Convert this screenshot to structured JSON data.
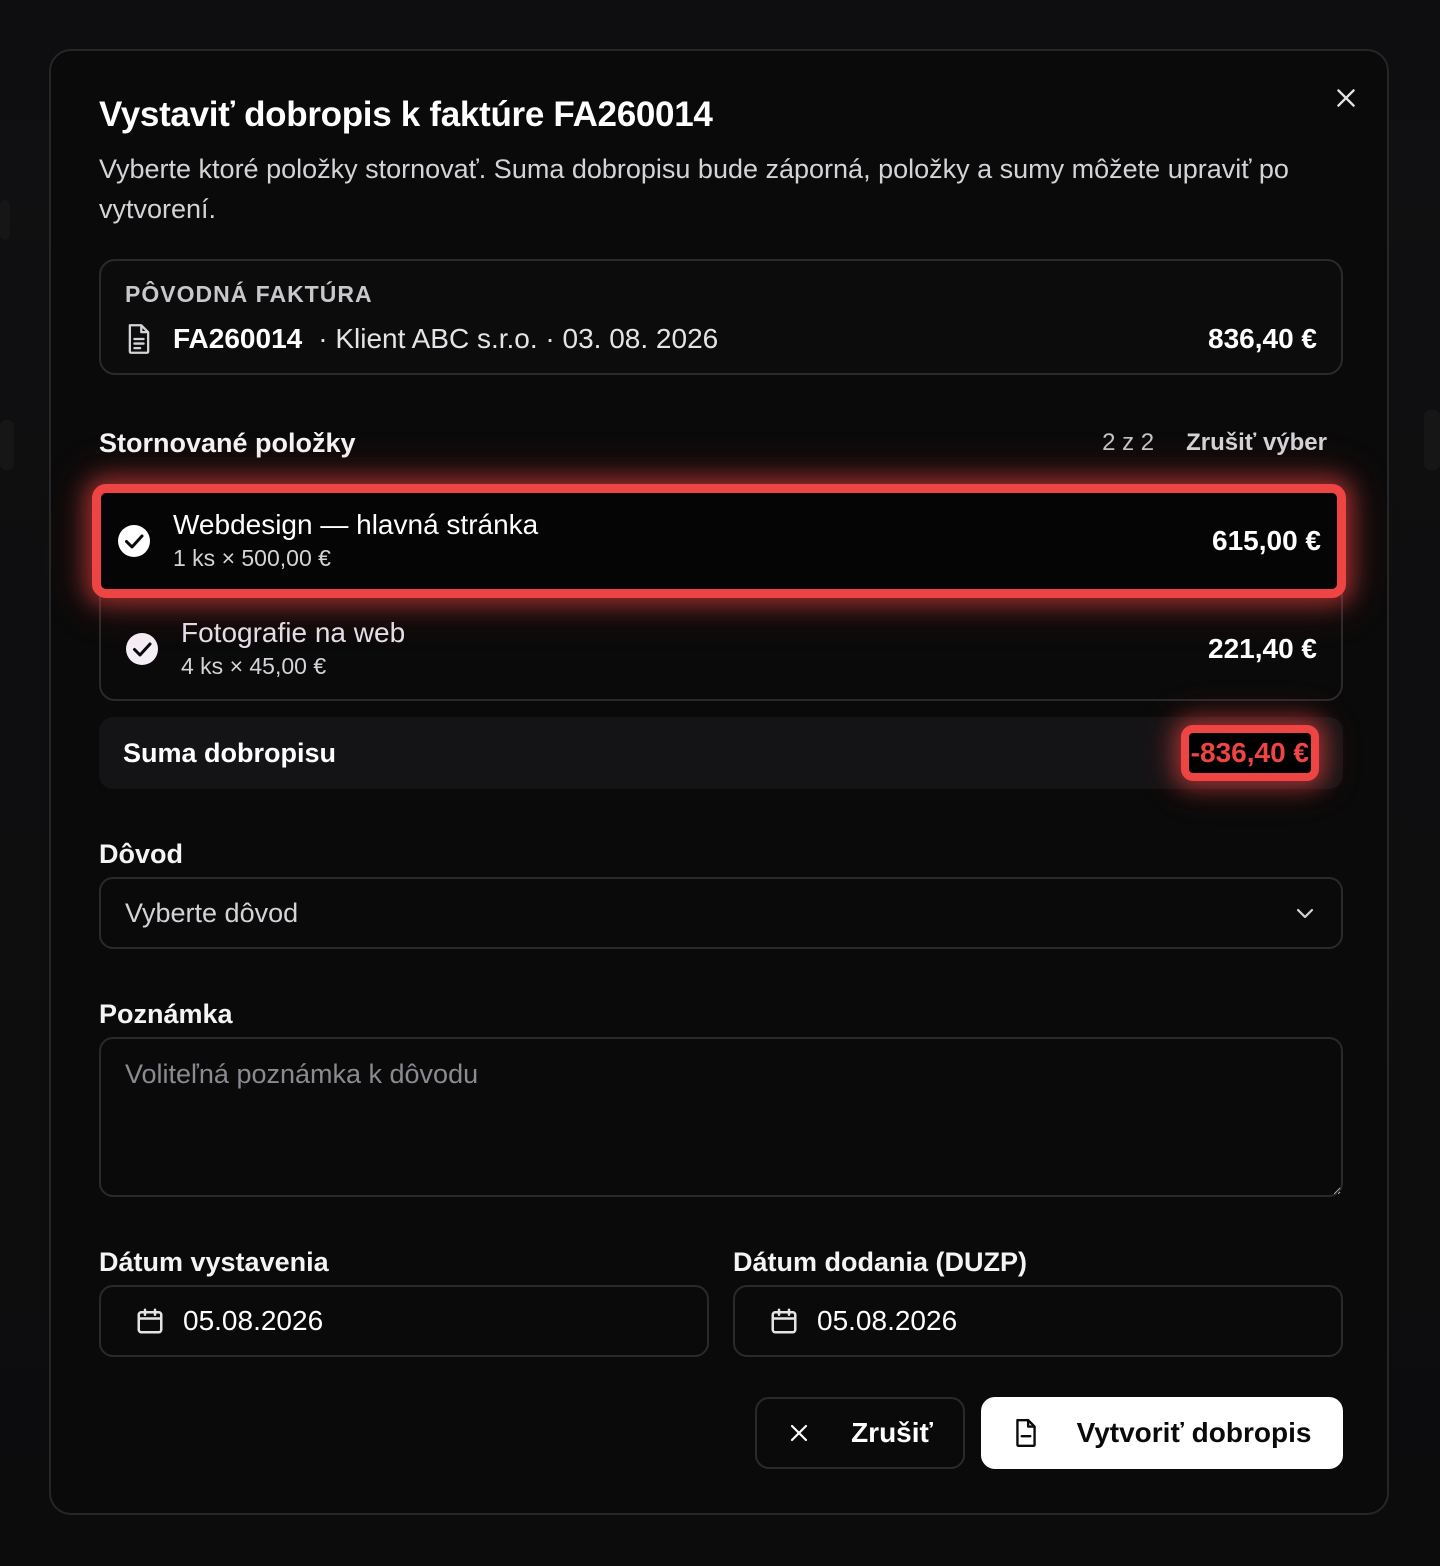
{
  "modal": {
    "title": "Vystaviť dobropis k faktúre FA260014",
    "subtitle": "Vyberte ktoré položky stornovať. Suma dobropisu bude záporná, položky a sumy môžete upraviť po vytvorení.",
    "close_icon": "close-icon"
  },
  "original_invoice": {
    "label": "PÔVODNÁ FAKTÚRA",
    "number": "FA260014",
    "meta": "· Klient ABC s.r.o. · 03. 08. 2026",
    "amount": "836,40 €",
    "icon": "document-icon"
  },
  "items_section": {
    "title": "Stornované položky",
    "count": "2 z 2",
    "clear_label": "Zrušiť výber",
    "items": [
      {
        "name": "Webdesign — hlavná stránka",
        "qty": "1 ks × 500,00 €",
        "amount": "615,00 €",
        "checked": true
      },
      {
        "name": "Fotografie na web",
        "qty": "4 ks × 45,00 €",
        "amount": "221,40 €",
        "checked": true
      }
    ]
  },
  "sum": {
    "label": "Suma dobropisu",
    "value": "-836,40 €",
    "color": "#ef4444"
  },
  "reason": {
    "label": "Dôvod",
    "placeholder": "Vyberte dôvod"
  },
  "note": {
    "label": "Poznámka",
    "placeholder": "Voliteľná poznámka k dôvodu"
  },
  "dates": {
    "issue_label": "Dátum vystavenia",
    "issue_value": "05.08.2026",
    "delivery_label": "Dátum dodania (DUZP)",
    "delivery_value": "05.08.2026"
  },
  "actions": {
    "cancel_label": "Zrušiť",
    "create_label": "Vytvoriť dobropis"
  },
  "colors": {
    "highlight": "#ef4444",
    "background": "#0a0a0a"
  }
}
